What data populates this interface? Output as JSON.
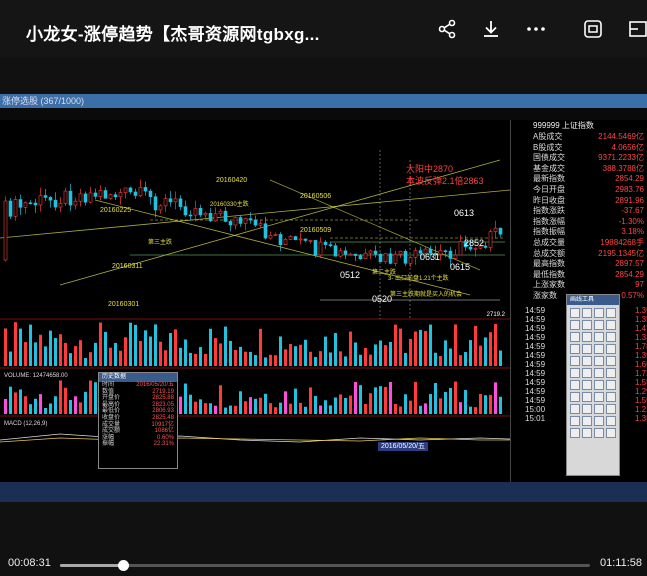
{
  "header": {
    "title": "小龙女-涨停趋势【杰哥资源网tgbxg..."
  },
  "toolbar": {
    "icons": [
      "share-icon",
      "download-icon",
      "more-icon",
      "screenshot-icon",
      "pip-icon"
    ]
  },
  "video": {
    "window_title": "涨停选股 (367/1000)",
    "index_name": "999999 上证指数",
    "chart_labels": {
      "peak": "20160420",
      "mid_peak": "20160506",
      "low1": "20160311",
      "low2": "20160301",
      "date1": "20160225",
      "low3": "20160509",
      "lbl_0512": "0512",
      "lbl_0520": "0520",
      "lbl_0613": "0613",
      "lbl_0615": "0615",
      "lbl_0631": "0631",
      "lbl_2852": "2852",
      "annot1": "大阳中2870",
      "annot2": "本波反弹2.1倍2863",
      "annot3": "第三主跌",
      "annot4": "20160330主跌",
      "annot5": "第二主跌",
      "annot6": "3- 出口前盘1.21个主跌",
      "annot7": "第三主跌期就是买入的机会",
      "vol_label": "VOLUME: 12474658.00",
      "macd_label": "MACD (12,26,9)",
      "selected_date": "2016/05/20/五"
    },
    "right_panel": {
      "rows": [
        {
          "label": "A股成交",
          "value": "2144.5469亿"
        },
        {
          "label": "B股成交",
          "value": "4.0656亿"
        },
        {
          "label": "国债成交",
          "value": "9371.2233亿"
        },
        {
          "label": "基金成交",
          "value": "388.3788亿"
        },
        {
          "label": "最新指数",
          "value": "2854.29"
        },
        {
          "label": "今日开盘",
          "value": "2983.76"
        },
        {
          "label": "昨日收盘",
          "value": "2891.96"
        },
        {
          "label": "指数涨跌",
          "value": "-37.67"
        },
        {
          "label": "指数涨幅",
          "value": "-1.30%"
        },
        {
          "label": "指数振幅",
          "value": "3.18%"
        },
        {
          "label": "总成交量",
          "value": "19884268手"
        },
        {
          "label": "总成交额",
          "value": "2195.1345亿"
        },
        {
          "label": "最高指数",
          "value": "2897.57"
        },
        {
          "label": "最低指数",
          "value": "2854.29"
        },
        {
          "label": "上涨家数",
          "value": "97"
        },
        {
          "label": "涨家数",
          "value": "0.57%"
        }
      ],
      "ticks": [
        {
          "time": "14:59",
          "value": "1.35"
        },
        {
          "time": "14:59",
          "value": "1.35"
        },
        {
          "time": "14:59",
          "value": "1.47"
        },
        {
          "time": "14:59",
          "value": "1.33"
        },
        {
          "time": "14:59",
          "value": "1.78"
        },
        {
          "time": "14:59",
          "value": "1.39"
        },
        {
          "time": "14:59",
          "value": "1.65"
        },
        {
          "time": "14:59",
          "value": "1.72"
        },
        {
          "time": "14:59",
          "value": "1.55"
        },
        {
          "time": "14:59",
          "value": "1.29"
        },
        {
          "time": "14:59",
          "value": "1.59"
        },
        {
          "time": "15:00",
          "value": "1.22"
        },
        {
          "time": "15:01",
          "value": "1.35"
        }
      ]
    },
    "info_window": {
      "title": "历史数据",
      "rows": [
        {
          "label": "时间",
          "value": "2016/05/20/五"
        },
        {
          "label": "数值",
          "value": "2719.19"
        },
        {
          "label": "开盘价",
          "value": "2825.88"
        },
        {
          "label": "最高价",
          "value": "2823.05"
        },
        {
          "label": "最低价",
          "value": "2806.93"
        },
        {
          "label": "收盘价",
          "value": "2825.48"
        },
        {
          "label": "成交量",
          "value": "10917亿"
        },
        {
          "label": "成交额",
          "value": "1086亿"
        },
        {
          "label": "涨幅",
          "value": "0.60%"
        },
        {
          "label": "振幅",
          "value": "22.31%"
        }
      ]
    },
    "tool_window_title": "画线工具",
    "bottom_axis_value": "2719.2"
  },
  "player": {
    "current_time": "00:08:31",
    "total_time": "01:11:58",
    "progress": 0.1183
  },
  "colors": {
    "up": "#ff3b3b",
    "down": "#21c2e0",
    "guide": "#d9d94a"
  }
}
